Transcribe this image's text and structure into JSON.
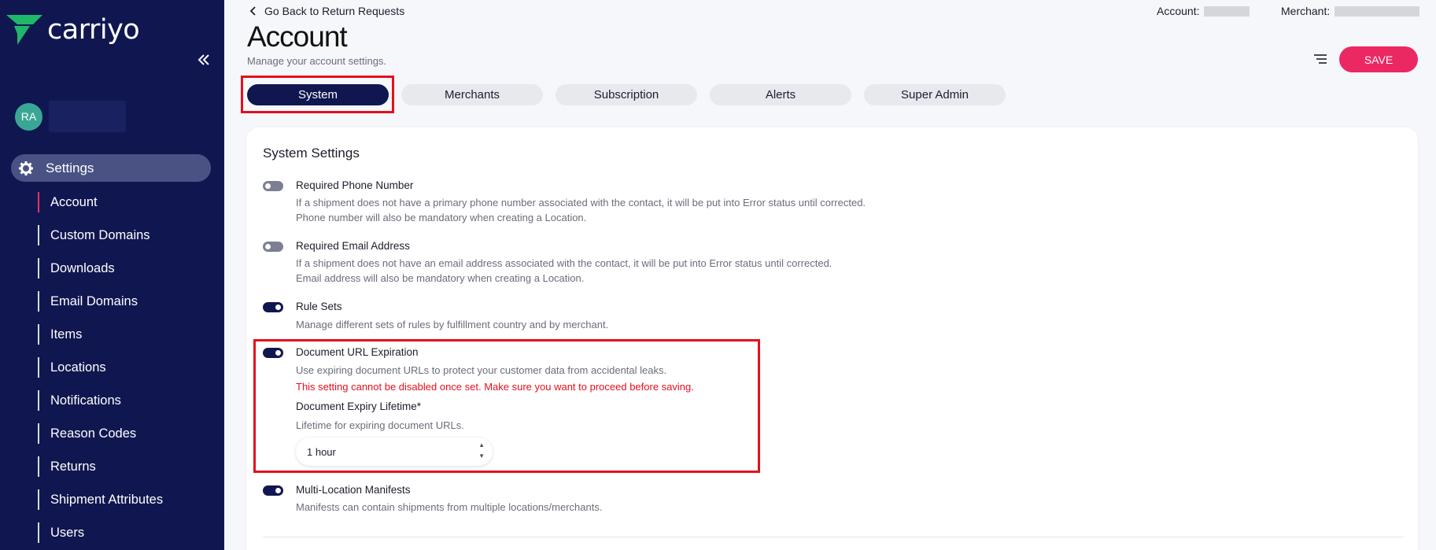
{
  "brand": {
    "name": "carriyo",
    "accent": "#1fb86b"
  },
  "sidebar": {
    "avatar_initials": "RA",
    "settings_label": "Settings",
    "items": [
      {
        "label": "Account",
        "active": true
      },
      {
        "label": "Custom Domains"
      },
      {
        "label": "Downloads"
      },
      {
        "label": "Email Domains"
      },
      {
        "label": "Items"
      },
      {
        "label": "Locations"
      },
      {
        "label": "Notifications"
      },
      {
        "label": "Reason Codes"
      },
      {
        "label": "Returns"
      },
      {
        "label": "Shipment Attributes"
      },
      {
        "label": "Users"
      }
    ]
  },
  "header": {
    "back_label": "Go Back to Return Requests",
    "title": "Account",
    "subtitle": "Manage your account settings.",
    "account_label": "Account:",
    "merchant_label": "Merchant:",
    "save_label": "SAVE"
  },
  "tabs": [
    {
      "label": "System",
      "active": true
    },
    {
      "label": "Merchants"
    },
    {
      "label": "Subscription"
    },
    {
      "label": "Alerts"
    },
    {
      "label": "Super Admin"
    }
  ],
  "system_settings": {
    "title": "System Settings",
    "required_phone": {
      "title": "Required Phone Number",
      "enabled": false,
      "desc1": "If a shipment does not have a primary phone number associated with the contact, it will be put into Error status until corrected.",
      "desc2": "Phone number will also be mandatory when creating a Location."
    },
    "required_email": {
      "title": "Required Email Address",
      "enabled": false,
      "desc1": "If a shipment does not have an email address associated with the contact, it will be put into Error status until corrected.",
      "desc2": "Email address will also be mandatory when creating a Location."
    },
    "rule_sets": {
      "title": "Rule Sets",
      "enabled": true,
      "desc": "Manage different sets of rules by fulfillment country and by merchant."
    },
    "doc_url_expiration": {
      "title": "Document URL Expiration",
      "enabled": true,
      "desc": "Use expiring document URLs to protect your customer data from accidental leaks.",
      "warning": "This setting cannot be disabled once set. Make sure you want to proceed before saving.",
      "lifetime_label": "Document Expiry Lifetime*",
      "lifetime_desc": "Lifetime for expiring document URLs.",
      "lifetime_value": "1 hour"
    },
    "multi_location": {
      "title": "Multi-Location Manifests",
      "enabled": true,
      "desc": "Manifests can contain shipments from multiple locations/merchants."
    }
  },
  "colors": {
    "sidebar_bg": "#101750",
    "save_button": "#ec2863",
    "highlight_border": "#e3101d",
    "warning_text": "#e3101d"
  }
}
